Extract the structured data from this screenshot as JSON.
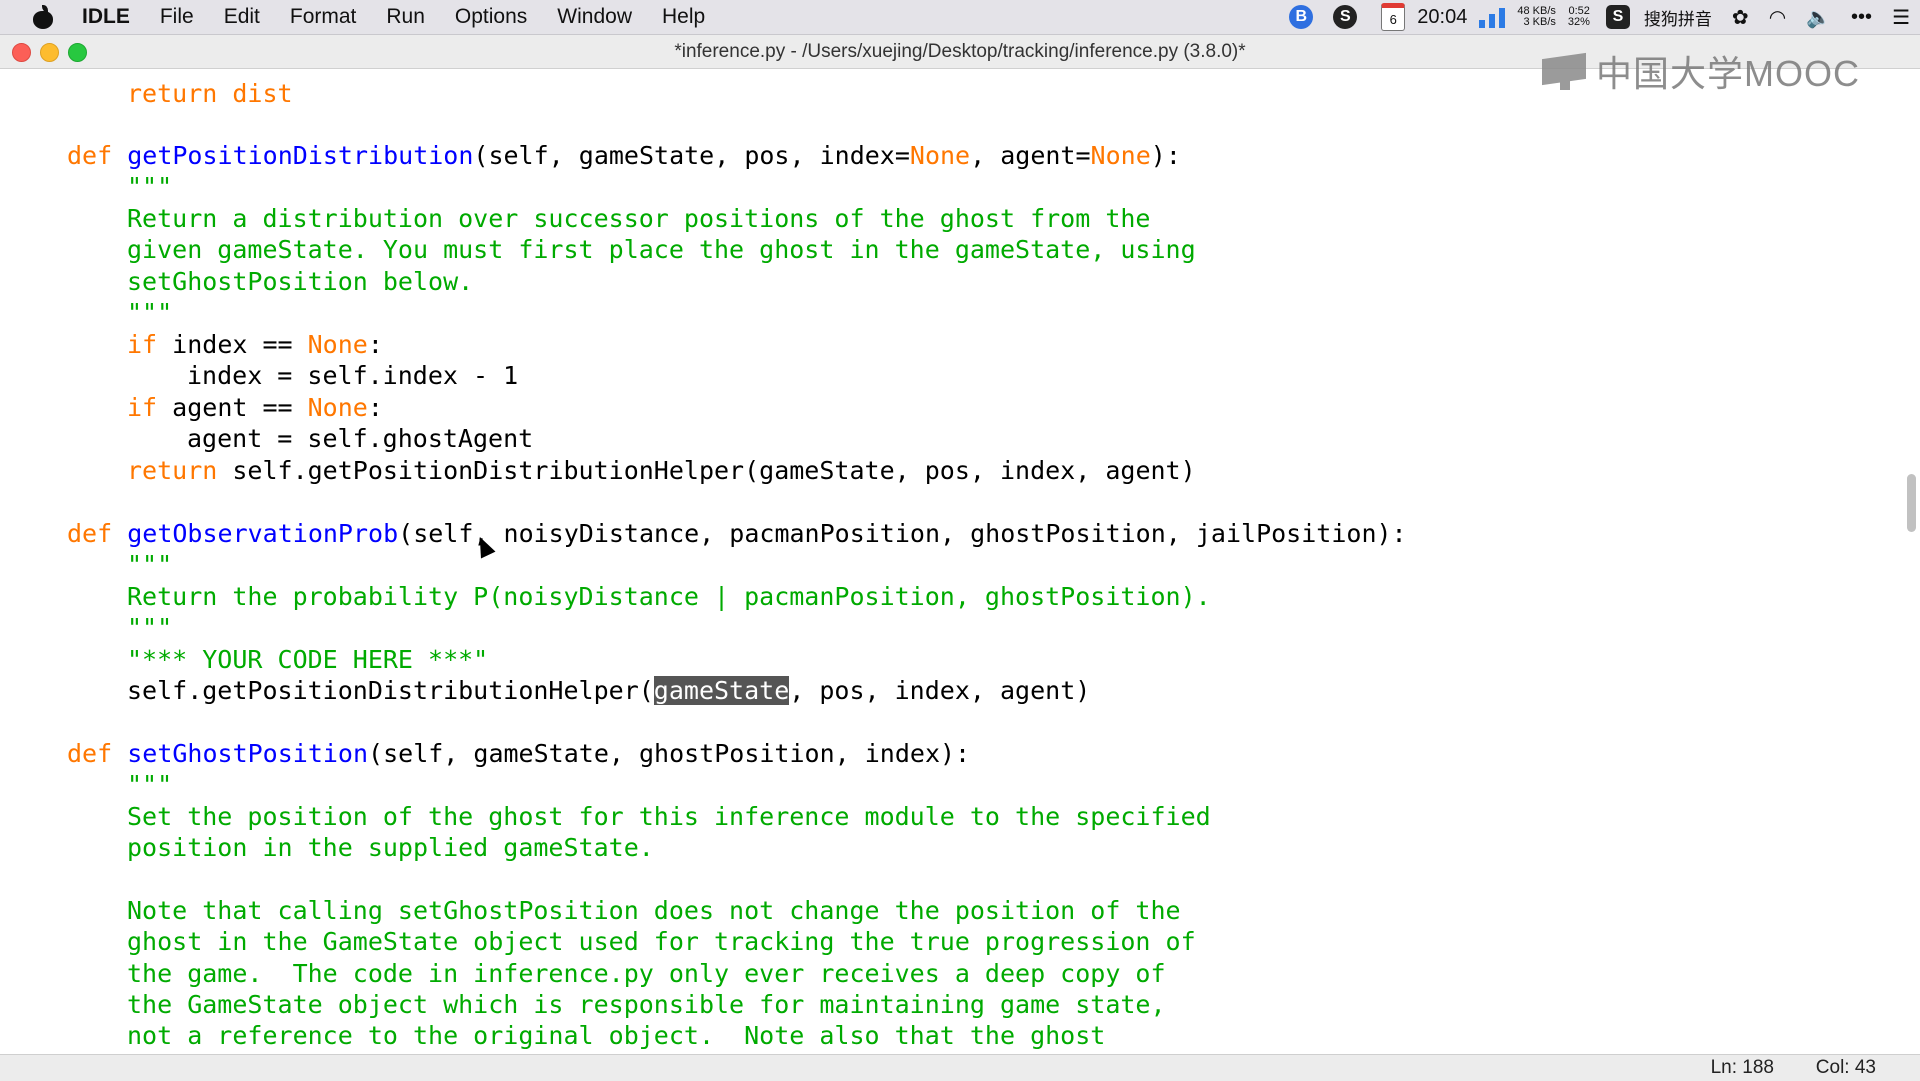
{
  "menubar": {
    "app": "IDLE",
    "items": [
      "File",
      "Edit",
      "Format",
      "Run",
      "Options",
      "Window",
      "Help"
    ],
    "status": {
      "calendar_day": "6",
      "clock": "20:04",
      "net_up": "48 KB/s",
      "net_down": "3 KB/s",
      "battery_time": "0:52",
      "battery_pct": "32%",
      "ime": "搜狗拼音"
    }
  },
  "window": {
    "title": "*inference.py - /Users/xuejing/Desktop/tracking/inference.py (3.8.0)*",
    "watermark": "中国大学MOOC"
  },
  "status_bar": {
    "ln": "Ln: 188",
    "col": "Col: 43"
  },
  "code": {
    "l0": "return dist",
    "l1_def": "def",
    "l1_name": "getPositionDistribution",
    "l1_a": "(self, gameState, pos, index=",
    "l1_none1": "None",
    "l1_b": ", agent=",
    "l1_none2": "None",
    "l1_c": "):",
    "l2": "\"\"\"",
    "l3": "Return a distribution over successor positions of the ghost from the",
    "l4": "given gameState. You must first place the ghost in the gameState, using",
    "l5": "setGhostPosition below.",
    "l6": "\"\"\"",
    "l7_if": "if",
    "l7_a": " index == ",
    "l7_none": "None",
    "l7_b": ":",
    "l8": "index = self.index - 1",
    "l9_if": "if",
    "l9_a": " agent == ",
    "l9_none": "None",
    "l9_b": ":",
    "l10": "agent = self.ghostAgent",
    "l11_ret": "return",
    "l11_a": " self.getPositionDistributionHelper(gameState, pos, index, agent)",
    "l12_def": "def",
    "l12_name": "getObservationProb",
    "l12_a": "(self, noisyDistance, pacmanPosition, ghostPosition, jailPosition):",
    "l13": "\"\"\"",
    "l14": "Return the probability P(noisyDistance | pacmanPosition, ghostPosition).",
    "l15": "\"\"\"",
    "l16": "\"*** YOUR CODE HERE ***\"",
    "l17_a": "self.getPositionDistributionHelper(",
    "l17_sel": "gameState",
    "l17_b": ", pos, index, agent)",
    "l18_def": "def",
    "l18_name": "setGhostPosition",
    "l18_a": "(self, gameState, ghostPosition, index):",
    "l19": "\"\"\"",
    "l20": "Set the position of the ghost for this inference module to the specified",
    "l21": "position in the supplied gameState.",
    "l22": "Note that calling setGhostPosition does not change the position of the",
    "l23": "ghost in the GameState object used for tracking the true progression of",
    "l24": "the game.  The code in inference.py only ever receives a deep copy of",
    "l25": "the GameState object which is responsible for maintaining game state,",
    "l26": "not a reference to the original object.  Note also that the ghost"
  }
}
